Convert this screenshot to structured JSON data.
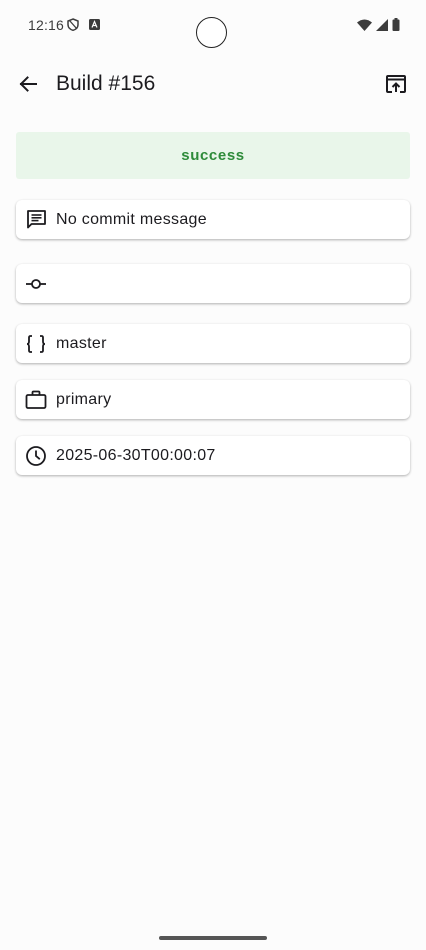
{
  "status_bar": {
    "time": "12:16"
  },
  "app_bar": {
    "title": "Build #156"
  },
  "build": {
    "status": "success",
    "status_color": "#2e8b3a",
    "commit_message": "No commit message",
    "commit_hash": "",
    "branch": "master",
    "worker": "primary",
    "timestamp": "2025-06-30T00:00:07"
  },
  "icons": {
    "back": "arrow-back-icon",
    "open": "open-in-browser-icon",
    "message": "message-icon",
    "commit": "commit-icon",
    "branch": "braces-icon",
    "worker": "briefcase-icon",
    "time": "clock-icon"
  }
}
